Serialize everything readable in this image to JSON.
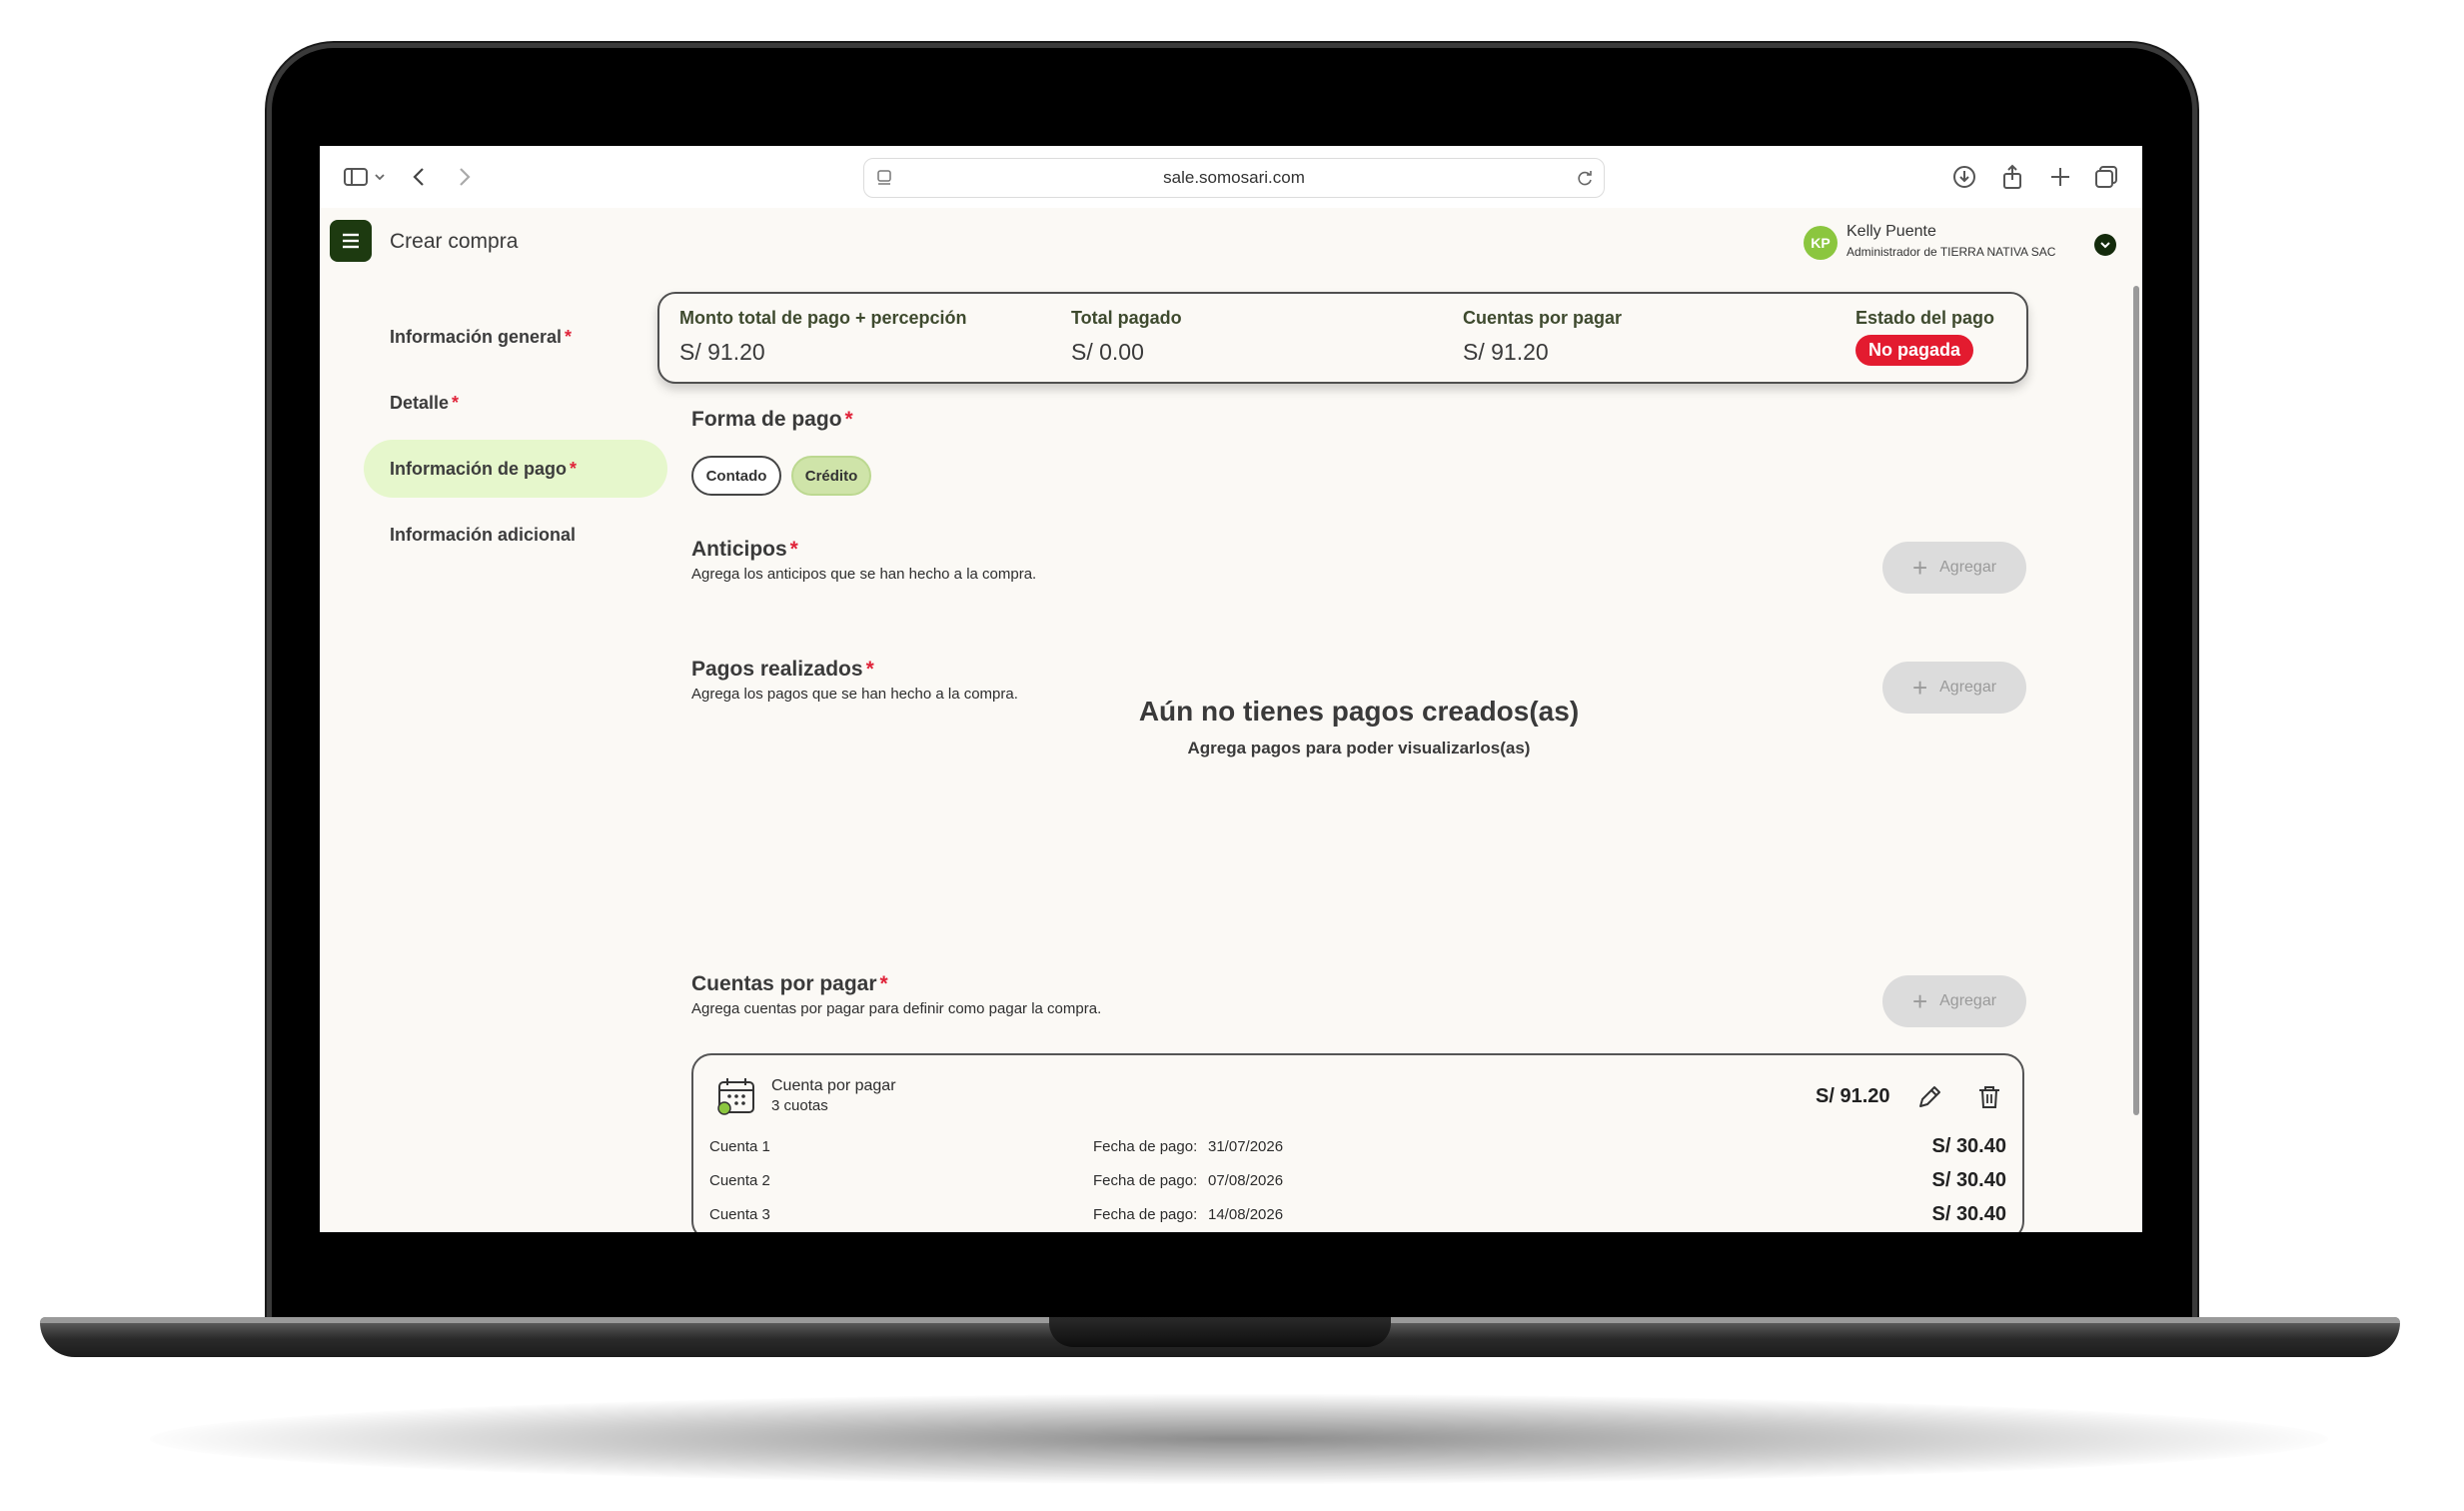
{
  "browser": {
    "url": "sale.somosari.com",
    "icons": [
      "sidebar-icon",
      "chevron-down-icon",
      "back-icon",
      "forward-icon",
      "download-icon",
      "share-icon",
      "new-tab-icon",
      "tabs-icon"
    ]
  },
  "header": {
    "title": "Crear compra",
    "user": {
      "initials": "KP",
      "name": "Kelly Puente",
      "role": "Administrador de TIERRA NATIVA SAC"
    }
  },
  "sidebar": {
    "items": [
      {
        "label": "Información general",
        "required": "*"
      },
      {
        "label": "Detalle",
        "required": "*"
      },
      {
        "label": "Información de pago",
        "required": "*",
        "active": true
      },
      {
        "label": "Información adicional"
      }
    ]
  },
  "summary": {
    "total_label": "Monto total de pago + percepción",
    "total_value": "S/ 91.20",
    "paid_label": "Total pagado",
    "paid_value": "S/ 0.00",
    "payable_label": "Cuentas por pagar",
    "payable_value": "S/ 91.20",
    "status_label": "Estado del pago",
    "status_value": "No pagada"
  },
  "forma_pago": {
    "title": "Forma de pago",
    "required": "*",
    "options": [
      "Contado",
      "Crédito"
    ],
    "selected": "Crédito"
  },
  "anticipos": {
    "title": "Anticipos",
    "required": "*",
    "desc": "Agrega los anticipos que se han hecho a la compra.",
    "button": "Agregar"
  },
  "pagos": {
    "title": "Pagos realizados",
    "required": "*",
    "desc": "Agrega los pagos que se han hecho a la compra.",
    "button": "Agregar",
    "empty_title": "Aún no tienes pagos creados(as)",
    "empty_sub": "Agrega pagos para poder visualizarlos(as)"
  },
  "cuentas": {
    "title": "Cuentas por pagar",
    "required": "*",
    "desc": "Agrega cuentas por pagar para definir como pagar la compra.",
    "button": "Agregar",
    "card": {
      "title": "Cuenta por pagar",
      "subtitle": "3 cuotas",
      "total": "S/ 91.20",
      "date_label": "Fecha de pago:",
      "rows": [
        {
          "name": "Cuenta 1",
          "date": "31/07/2026",
          "amount": "S/ 30.40"
        },
        {
          "name": "Cuenta 2",
          "date": "07/08/2026",
          "amount": "S/ 30.40"
        },
        {
          "name": "Cuenta 3",
          "date": "14/08/2026",
          "amount": "S/ 30.40"
        }
      ]
    }
  },
  "colors": {
    "brand_dark": "#1d3a10",
    "active_nav": "#e6f7cc",
    "selected_pill": "#cfe4a9",
    "status_red": "#e31b2f",
    "avatar": "#8bc63f"
  }
}
